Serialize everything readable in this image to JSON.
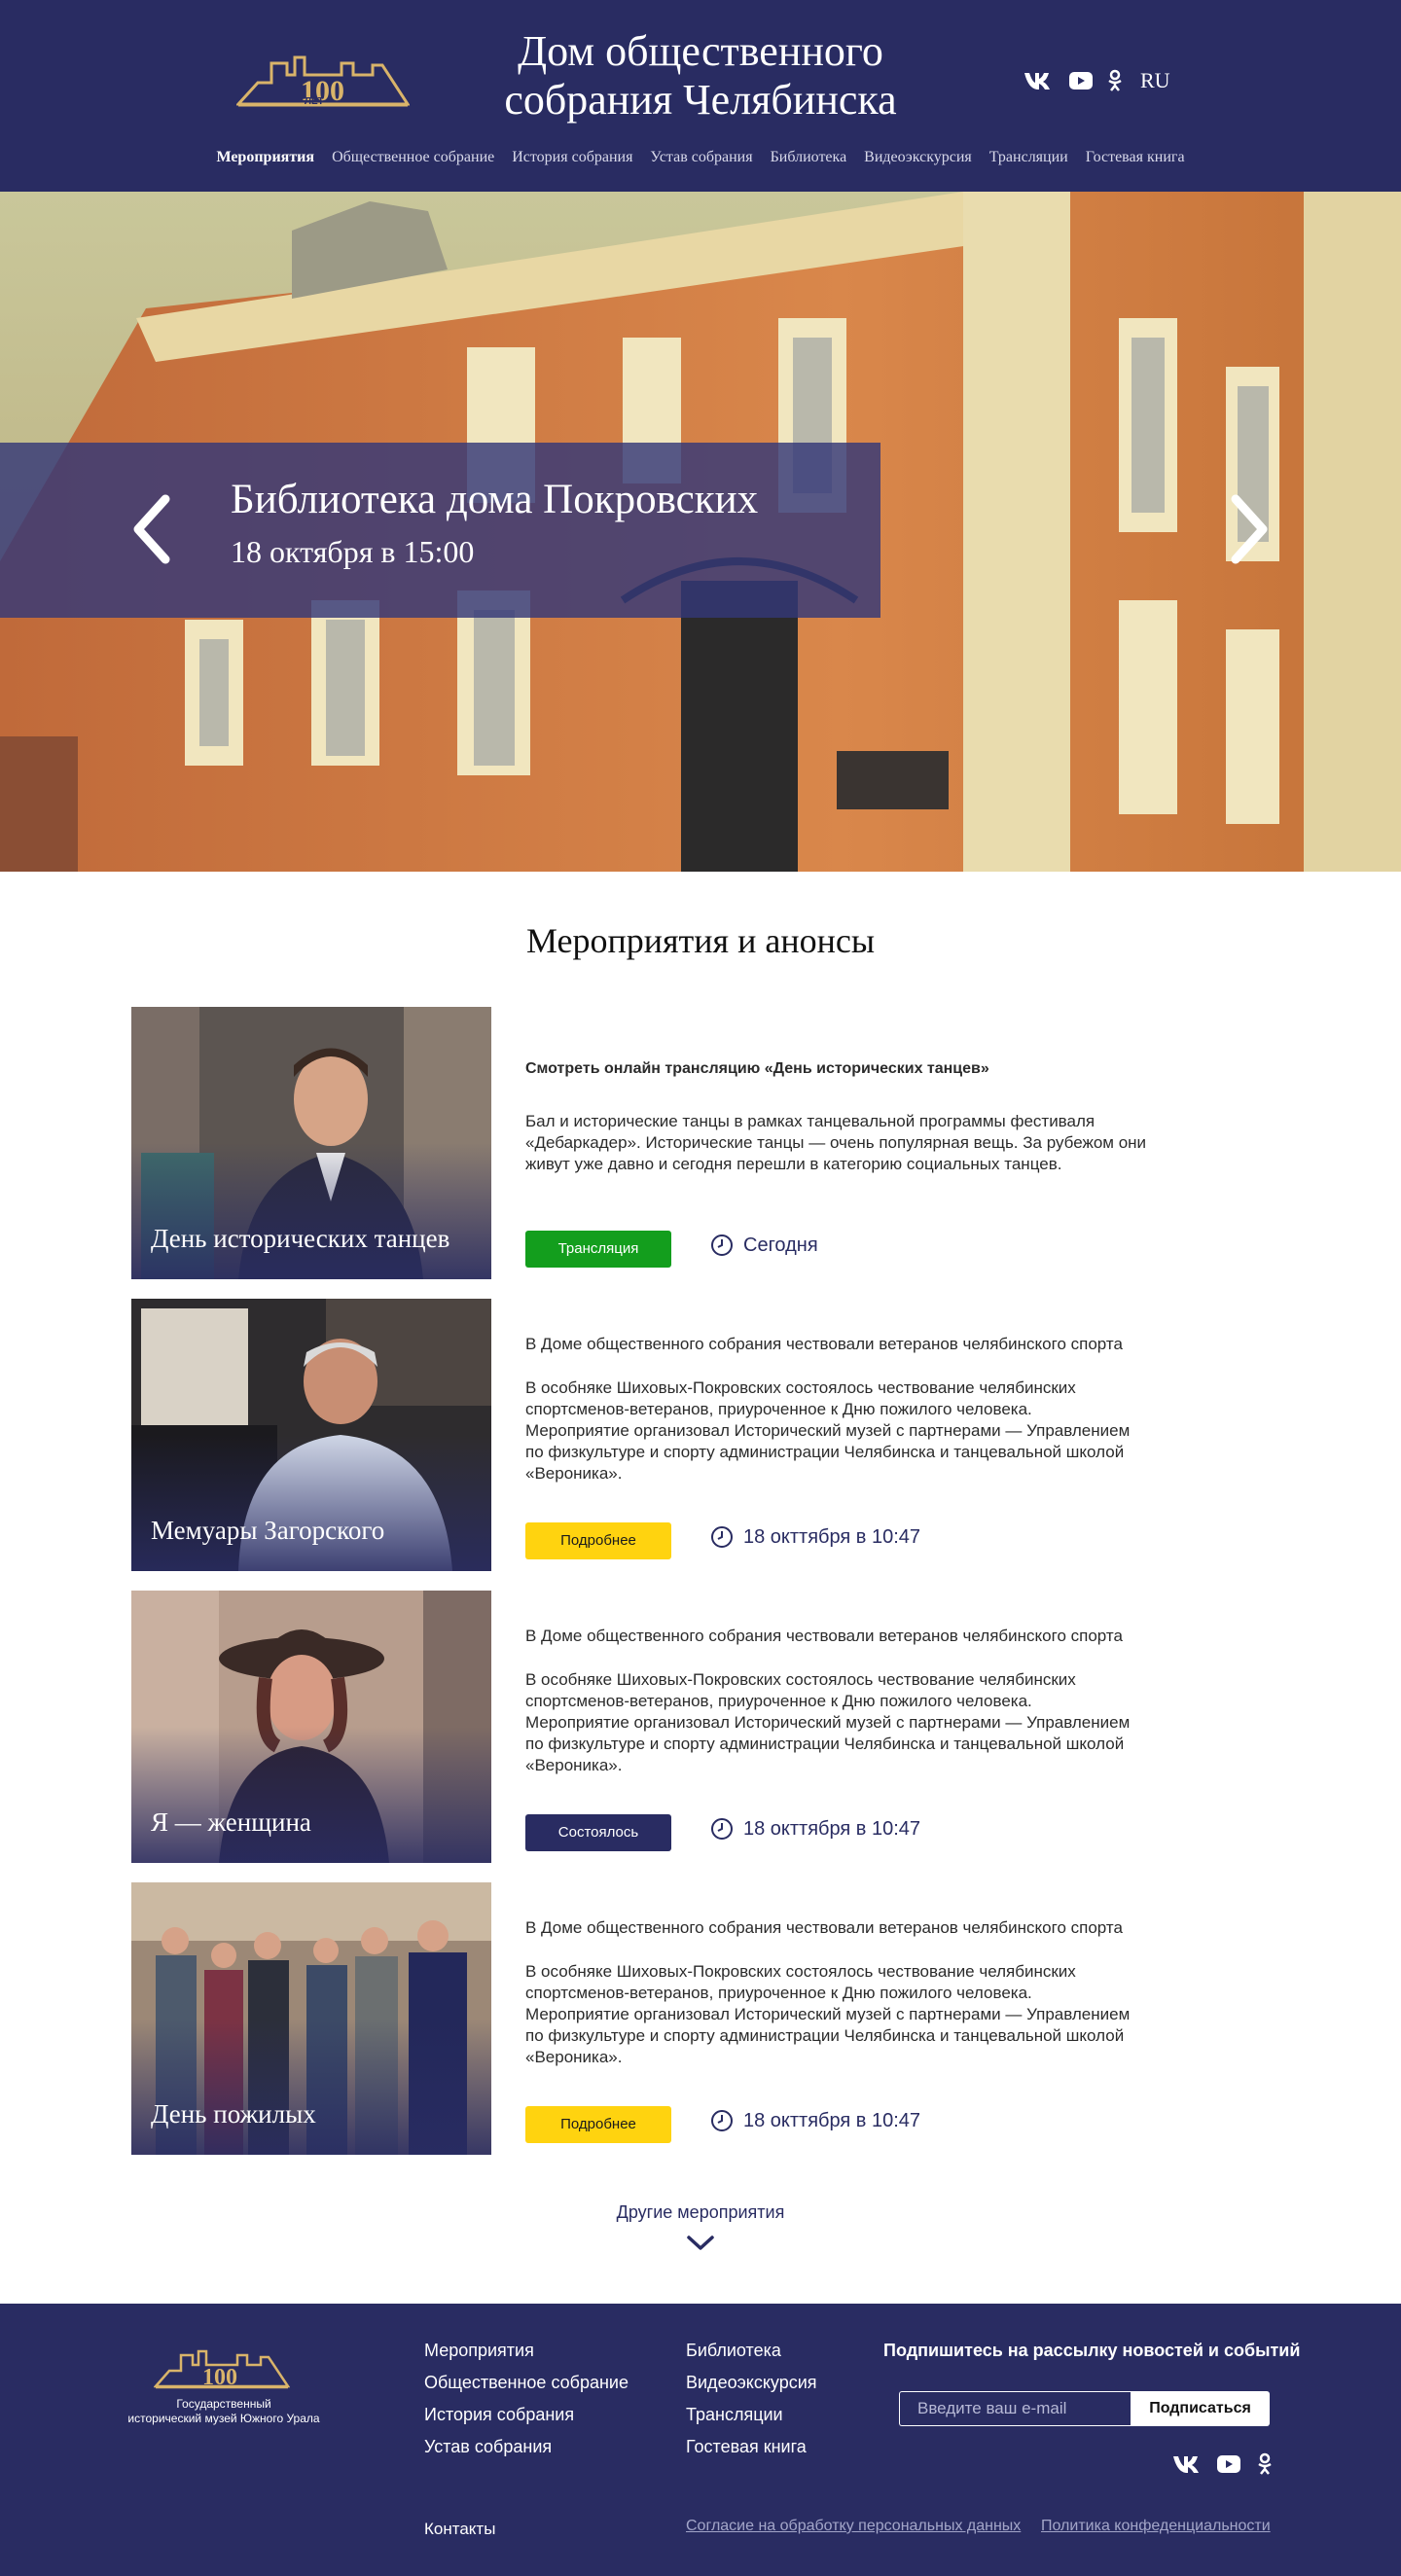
{
  "header": {
    "title_line1": "Дом общественного",
    "title_line2": "собрания Челябинска",
    "logo_text": "ЛЕТ",
    "lang": "RU",
    "social": [
      "vk-icon",
      "youtube-icon",
      "odnoklassniki-icon"
    ],
    "nav": [
      {
        "label": "Мероприятия",
        "active": true
      },
      {
        "label": "Общественное собрание",
        "active": false
      },
      {
        "label": "История собрания",
        "active": false
      },
      {
        "label": "Устав собрания",
        "active": false
      },
      {
        "label": "Библиотека",
        "active": false
      },
      {
        "label": "Видеоэкскурсия",
        "active": false
      },
      {
        "label": "Трансляции",
        "active": false
      },
      {
        "label": "Гостевая книга",
        "active": false
      }
    ]
  },
  "hero": {
    "title": "Библиотека дома Покровских",
    "date": "18 октября в 15:00"
  },
  "events_section": {
    "title": "Мероприятия и анонсы",
    "more_label": "Другие мероприятия"
  },
  "events": [
    {
      "caption": "День исторических танцев",
      "title": "Смотреть онлайн трансляцию «День исторических танцев»",
      "text": [
        "Бал и исторические танцы в рамках танцевальной программы фестиваля",
        "«Дебаркадер». Исторические танцы — очень популярная вещь. За рубежом они",
        "живут уже давно и сегодня перешли в категорию социальных танцев."
      ],
      "button": "Трансляция",
      "date": "Сегодня"
    },
    {
      "caption": "Мемуары Загорского",
      "title": "В Доме общественного собрания чествовали ветеранов челябинского спорта",
      "text": [
        "В особняке Шиховых-Покровских состоялось чествование челябинских",
        "спортсменов-ветеранов, приуроченное к Дню пожилого человека.",
        "Мероприятие организовал Исторический музей с партнерами — Управлением",
        " по физкультуре и спорту администрации Челябинска и танцевальной школой",
        "«Вероника»."
      ],
      "button": "Подробнее",
      "date": "18 окттября в 10:47"
    },
    {
      "caption": "Я — женщина",
      "title": "В Доме общественного собрания чествовали ветеранов челябинского спорта",
      "text": [
        "В особняке Шиховых-Покровских состоялось чествование челябинских",
        "спортсменов-ветеранов, приуроченное к Дню пожилого человека.",
        "Мероприятие организовал Исторический музей с партнерами — Управлением",
        " по физкультуре и спорту администрации Челябинска и танцевальной школой",
        "«Вероника»."
      ],
      "button": "Состоялось",
      "date": "18 окттября в 10:47"
    },
    {
      "caption": "День пожилых",
      "title": "В Доме общественного собрания чествовали ветеранов челябинского спорта",
      "text": [
        "В особняке Шиховых-Покровских состоялось чествование челябинских",
        "спортсменов-ветеранов, приуроченное к Дню пожилого человека.",
        "Мероприятие организовал Исторический музей с партнерами — Управлением",
        " по физкультуре и спорту администрации Челябинска и танцевальной школой",
        "«Вероника»."
      ],
      "button": "Подробнее",
      "date": "18 окттября в 10:47"
    }
  ],
  "footer": {
    "museum_line1": "Государственный",
    "museum_line2": "исторический музей Южного Урала",
    "col1": [
      "Мероприятия",
      "Общественное собрание",
      "История собрания",
      "Устав собрания"
    ],
    "col2": [
      "Библиотека",
      "Видеоэкскурсия",
      "Трансляции",
      "Гостевая книга"
    ],
    "subscribe_title": "Подпишитесь на рассылку новостей и событий",
    "email_placeholder": "Введите ваш e-mail",
    "subscribe_button": "Подписаться",
    "contacts": "Контакты",
    "consent": "Согласие на обработку персональных данных",
    "privacy": "Политика конфеденциальности"
  },
  "colors": {
    "navy": "#292c62",
    "green_button": "#139e1d",
    "yellow_button": "#ffd30f",
    "gold_logo": "#d9b46a"
  }
}
